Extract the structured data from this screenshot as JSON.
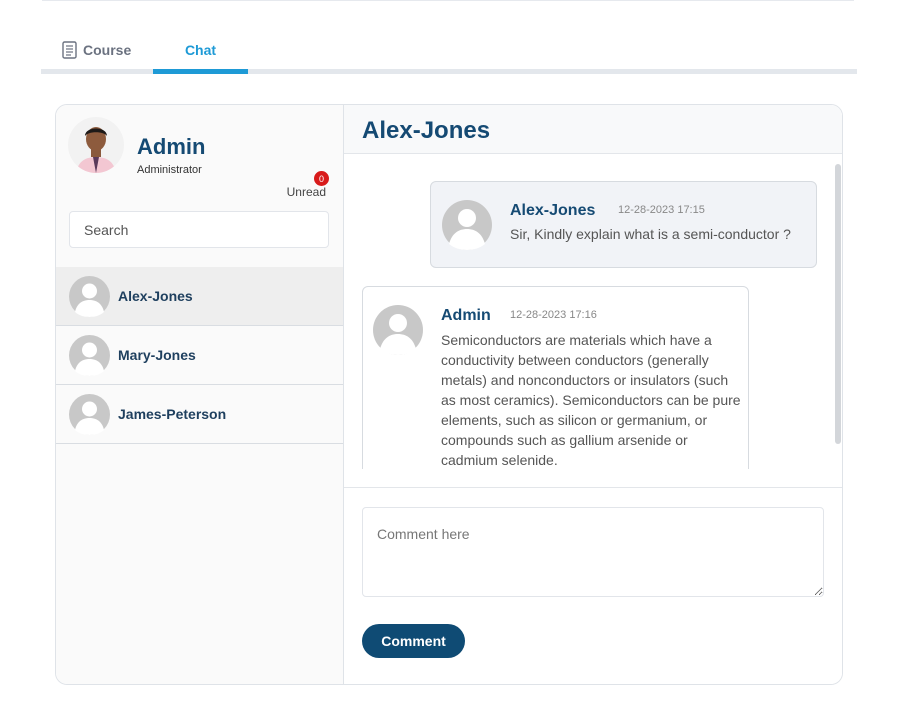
{
  "tabs": [
    {
      "label": "Course",
      "icon": "document-icon",
      "active": false
    },
    {
      "label": "Chat",
      "active": true
    }
  ],
  "accent_color": "#1e9ad6",
  "brand_color": "#154a73",
  "sidebar": {
    "user": {
      "name": "Admin",
      "role": "Administrator"
    },
    "unread": {
      "label": "Unread",
      "count": "0"
    },
    "search": {
      "placeholder": "Search"
    },
    "contacts": [
      {
        "name": "Alex-Jones",
        "active": true
      },
      {
        "name": "Mary-Jones",
        "active": false
      },
      {
        "name": "James-Peterson",
        "active": false
      }
    ]
  },
  "chat": {
    "title": "Alex-Jones",
    "messages": [
      {
        "sender": "Alex-Jones",
        "time": "12-28-2023 17:15",
        "text": "Sir, Kindly explain what is a semi-conductor ?"
      },
      {
        "sender": "Admin",
        "time": "12-28-2023 17:16",
        "text": "Semiconductors are materials which have a conductivity between conductors (generally metals) and nonconductors or insulators (such as most ceramics). Semiconductors can be pure elements, such as silicon or germanium, or compounds such as gallium arsenide or cadmium selenide."
      }
    ],
    "comment": {
      "placeholder": "Comment here",
      "button_label": "Comment"
    }
  }
}
